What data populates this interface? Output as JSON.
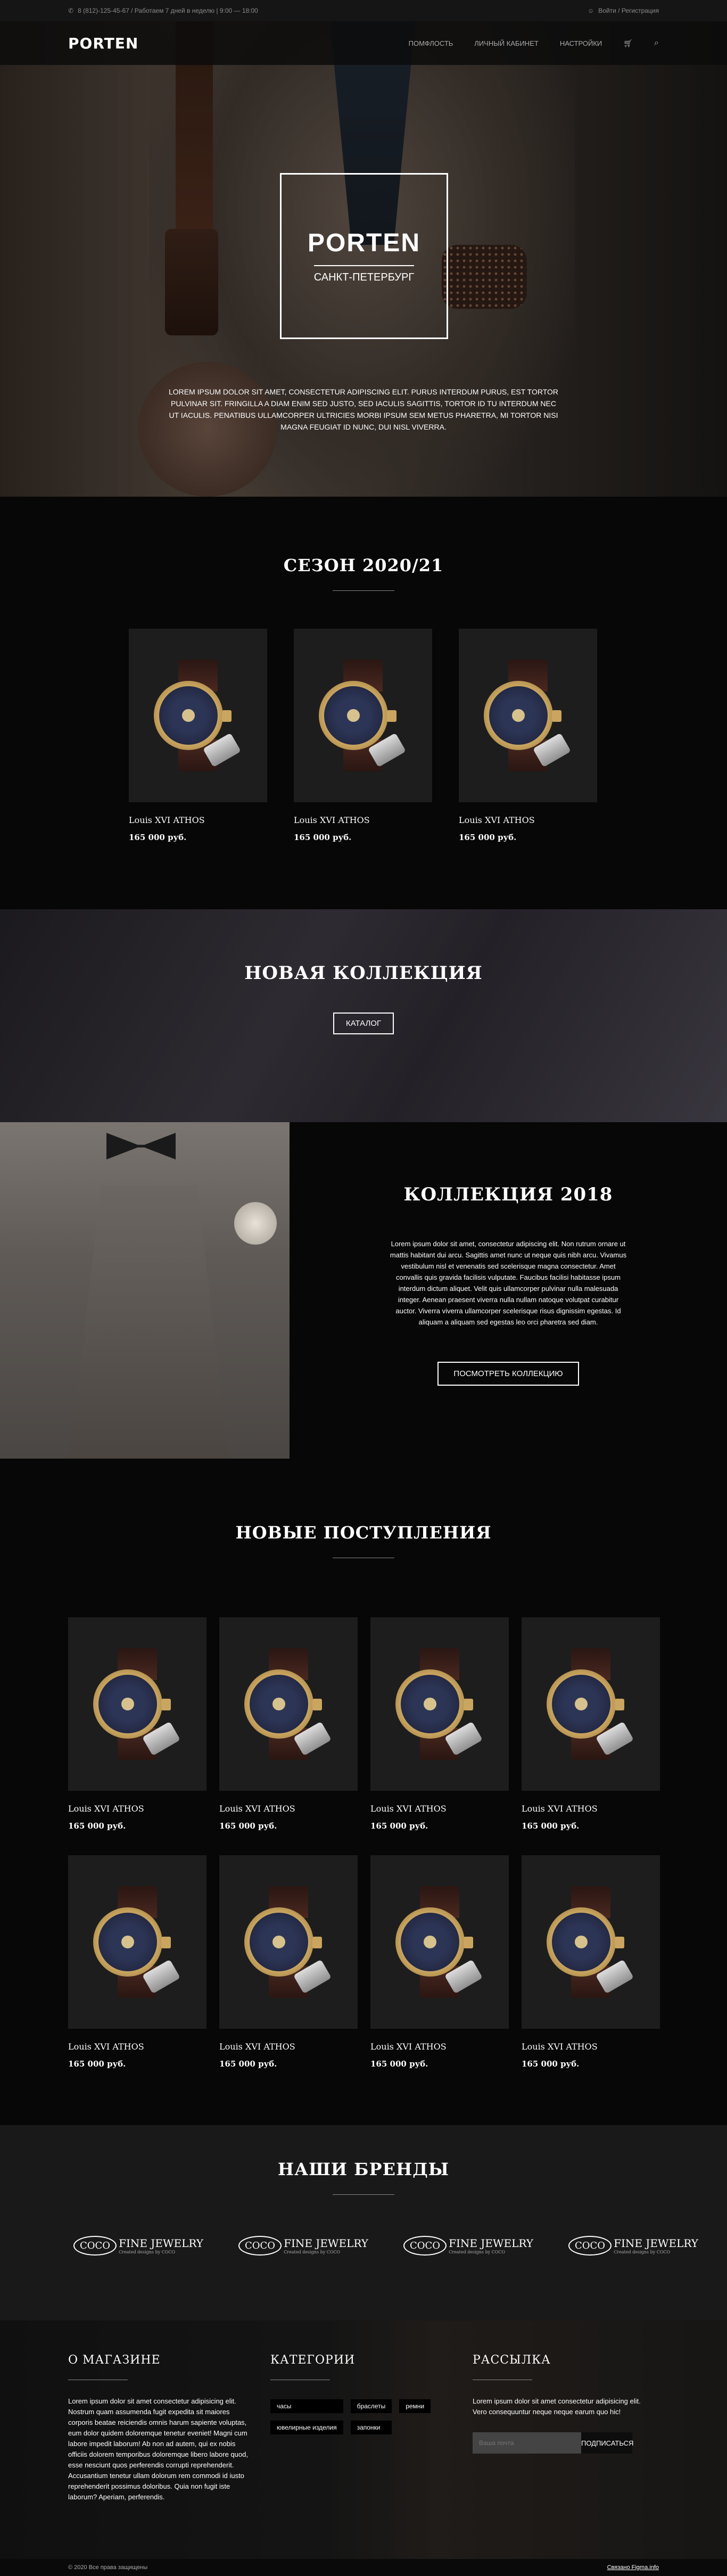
{
  "topbar": {
    "phone": "8 (812)-125-45-67 / Работаем 7 дней в неделю | 9:00 — 18:00",
    "auth": "Войти / Регистрация"
  },
  "nav": {
    "logo": "PORTEN",
    "items": [
      "ПОМФЛОСТЬ",
      "ЛИЧНЫЙ КАБИНЕТ",
      "НАСТРОЙКИ"
    ]
  },
  "hero": {
    "brand": "PORTEN",
    "city": "САНКТ-ПЕТЕРБУРГ",
    "text": "Lorem ipsum dolor sit amet, consectetur adipiscing elit. Purus interdum purus, est tortor pulvinar sit. Fringilla a diam enim sed justo, sed iaculis sagittis, tortor id tu interdum nec ut iaculis. Penatibus ullamcorper ultricies morbi ipsum sem metus pharetra, mi tortor nisi magna feugiat id nunc, dui nisl viverra."
  },
  "season": {
    "title": "СЕЗОН 2020/21",
    "products": [
      {
        "name": "Louis XVI ATHOS",
        "price": "165 000 руб."
      },
      {
        "name": "Louis XVI ATHOS",
        "price": "165 000 руб."
      },
      {
        "name": "Louis XVI ATHOS",
        "price": "165 000 руб."
      }
    ]
  },
  "newcol": {
    "title": "НОВАЯ КОЛЛЕКЦИЯ",
    "button": "КАТАЛОГ"
  },
  "col2018": {
    "title": "КОЛЛЕКЦИЯ 2018",
    "text": "Lorem ipsum dolor sit amet, consectetur adipiscing elit. Non rutrum ornare ut mattis habitant dui arcu. Sagittis amet nunc ut neque quis nibh arcu. Vivamus vestibulum nisl et venenatis sed scelerisque magna consectetur. Amet convallis quis gravida facilisis vulputate. Faucibus facilisi habitasse ipsum interdum dictum aliquet. Velit quis ullamcorper pulvinar nulla malesuada integer. Aenean praesent viverra nulla nullam natoque volutpat curabitur auctor. Viverra viverra ullamcorper scelerisque risus dignissim egestas. Id aliquam a aliquam sed egestas leo orci pharetra sed diam.",
    "button": "ПОСМОТРЕТЬ КОЛЛЕКЦИЮ"
  },
  "arrivals": {
    "title": "НОВЫЕ ПОСТУПЛЕНИЯ",
    "products": [
      {
        "name": "Louis XVI ATHOS",
        "price": "165 000 руб."
      },
      {
        "name": "Louis XVI ATHOS",
        "price": "165 000 руб."
      },
      {
        "name": "Louis XVI ATHOS",
        "price": "165 000 руб."
      },
      {
        "name": "Louis XVI ATHOS",
        "price": "165 000 руб."
      },
      {
        "name": "Louis XVI ATHOS",
        "price": "165 000 руб."
      },
      {
        "name": "Louis XVI ATHOS",
        "price": "165 000 руб."
      },
      {
        "name": "Louis XVI ATHOS",
        "price": "165 000 руб."
      },
      {
        "name": "Louis XVI ATHOS",
        "price": "165 000 руб."
      }
    ]
  },
  "brands": {
    "title": "НАШИ БРЕНДЫ",
    "items": [
      {
        "mark": "COCO",
        "name": "FINE JEWELRY",
        "tagline": "Created designs by COCO"
      },
      {
        "mark": "COCO",
        "name": "FINE JEWELRY",
        "tagline": "Created designs by COCO"
      },
      {
        "mark": "COCO",
        "name": "FINE JEWELRY",
        "tagline": "Created designs by COCO"
      },
      {
        "mark": "COCO",
        "name": "FINE JEWELRY",
        "tagline": "Created designs by COCO"
      }
    ]
  },
  "footer": {
    "about": {
      "title": "О МАГАЗИНЕ",
      "text": "Lorem ipsum dolor sit amet consectetur adipisicing elit. Nostrum quam assumenda fugit expedita sit maiores corporis beatae reiciendis omnis harum sapiente voluptas, eum dolor quidem doloremque tenetur eveniet! Magni cum labore impedit laborum! Ab non ad autem, qui ex nobis officiis dolorem temporibus doloremque libero labore quod, esse nesciunt quos perferendis corrupti reprehenderit. Accusantium tenetur ullam dolorum rem commodi id iusto reprehenderit possimus doloribus. Quia non fugit iste laborum? Aperiam, perferendis."
    },
    "categories": {
      "title": "КАТЕГОРИИ",
      "items": [
        "часы",
        "браслеты",
        "ремни",
        "ювелирные изделия",
        "запонки"
      ]
    },
    "newsletter": {
      "title": "РАССЫЛКА",
      "text": "Lorem ipsum dolor sit amet consectetur adipisicing elit. Vero consequuntur neque neque earum quo hic!",
      "placeholder": "Ваша почта",
      "button": "ПОДПИСАТЬСЯ"
    }
  },
  "bottom": {
    "copyright": "© 2020 Все права защищены",
    "link": "Связано Figma.info"
  }
}
